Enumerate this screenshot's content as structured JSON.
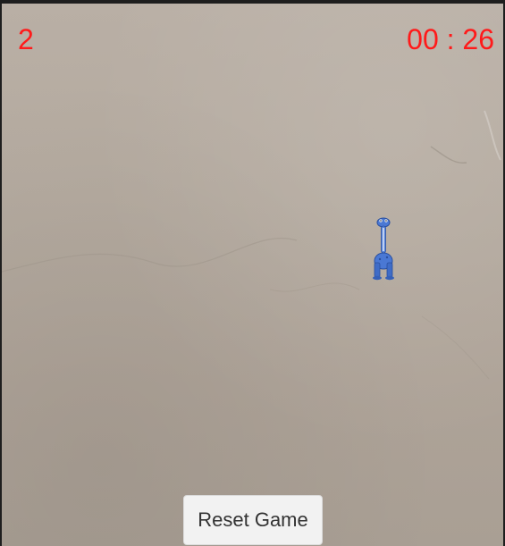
{
  "hud": {
    "score": "2",
    "timer": "00 : 26"
  },
  "target": {
    "icon": "blue-dinosaur-icon"
  },
  "controls": {
    "reset_label": "Reset Game"
  },
  "colors": {
    "hud_text": "#ff1a1a",
    "button_bg": "#f2f2f2",
    "button_text": "#333333",
    "dino_body": "#4a78d4"
  }
}
